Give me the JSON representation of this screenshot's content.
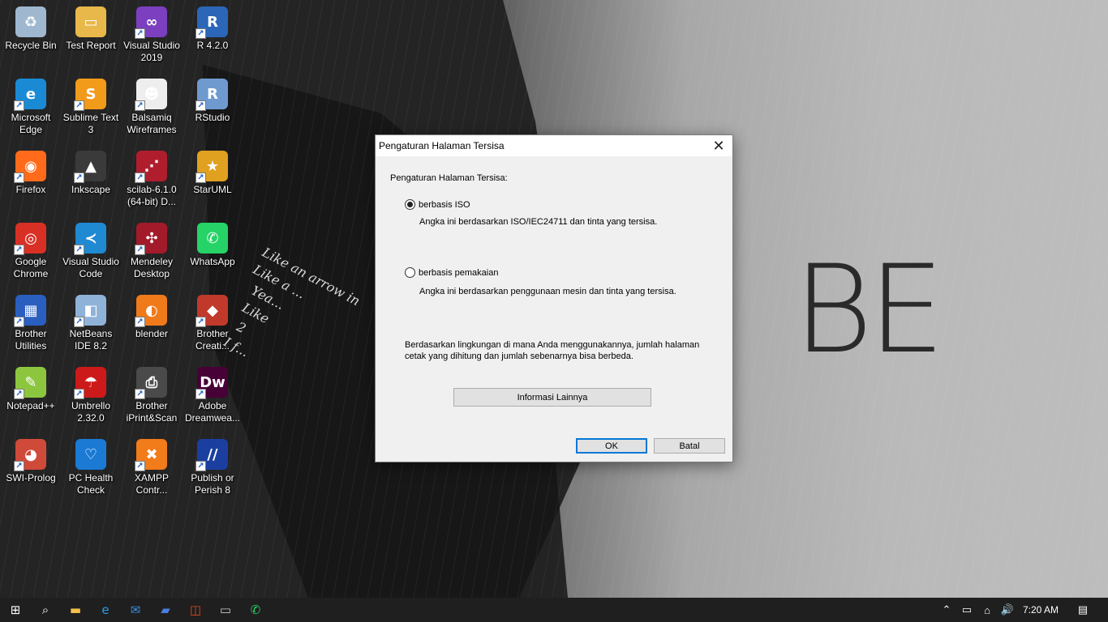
{
  "desktop": {
    "icons": [
      {
        "label": "Recycle Bin",
        "icon": "recycle-bin-icon",
        "color": "#9fb8d0",
        "glyph": "♻",
        "shortcut": false
      },
      {
        "label": "Test Report",
        "icon": "folder-icon",
        "color": "#e8b84a",
        "glyph": "▭",
        "shortcut": false
      },
      {
        "label": "Visual Studio 2019",
        "icon": "visual-studio-icon",
        "color": "#7b3fc0",
        "glyph": "∞",
        "shortcut": true
      },
      {
        "label": "R 4.2.0",
        "icon": "r-icon",
        "color": "#2b66b8",
        "glyph": "R",
        "shortcut": true
      },
      {
        "label": "Microsoft Edge",
        "icon": "edge-icon",
        "color": "#1a8ad4",
        "glyph": "e",
        "shortcut": true
      },
      {
        "label": "Sublime Text 3",
        "icon": "sublime-text-icon",
        "color": "#f29a1a",
        "glyph": "S",
        "shortcut": true
      },
      {
        "label": "Balsamiq Wireframes",
        "icon": "balsamiq-icon",
        "color": "#eeeeee",
        "glyph": "☻",
        "shortcut": true
      },
      {
        "label": "RStudio",
        "icon": "rstudio-icon",
        "color": "#6f9ad0",
        "glyph": "R",
        "shortcut": true
      },
      {
        "label": "Firefox",
        "icon": "firefox-icon",
        "color": "#ff6b1a",
        "glyph": "◉",
        "shortcut": true
      },
      {
        "label": "Inkscape",
        "icon": "inkscape-icon",
        "color": "#3a3a3a",
        "glyph": "▲",
        "shortcut": true
      },
      {
        "label": "scilab-6.1.0 (64-bit) D...",
        "icon": "scilab-icon",
        "color": "#b01e2e",
        "glyph": "⋰",
        "shortcut": true
      },
      {
        "label": "StarUML",
        "icon": "staruml-icon",
        "color": "#e0a020",
        "glyph": "★",
        "shortcut": true
      },
      {
        "label": "Google Chrome",
        "icon": "chrome-icon",
        "color": "#d93025",
        "glyph": "◎",
        "shortcut": true
      },
      {
        "label": "Visual Studio Code",
        "icon": "vscode-icon",
        "color": "#1f8ad2",
        "glyph": "≺",
        "shortcut": true
      },
      {
        "label": "Mendeley Desktop",
        "icon": "mendeley-icon",
        "color": "#a31a2a",
        "glyph": "✣",
        "shortcut": true
      },
      {
        "label": "WhatsApp",
        "icon": "whatsapp-icon",
        "color": "#25d366",
        "glyph": "✆",
        "shortcut": false
      },
      {
        "label": "Brother Utilities",
        "icon": "brother-utilities-icon",
        "color": "#2a5fc0",
        "glyph": "▦",
        "shortcut": true
      },
      {
        "label": "NetBeans IDE 8.2",
        "icon": "netbeans-icon",
        "color": "#8fb3d8",
        "glyph": "◧",
        "shortcut": true
      },
      {
        "label": "blender",
        "icon": "blender-icon",
        "color": "#f07a1a",
        "glyph": "◐",
        "shortcut": true
      },
      {
        "label": "Brother Creati...",
        "icon": "brother-creative-icon",
        "color": "#c0392b",
        "glyph": "◆",
        "shortcut": true
      },
      {
        "label": "Notepad++",
        "icon": "notepad-plus-plus-icon",
        "color": "#8cc63f",
        "glyph": "✎",
        "shortcut": true
      },
      {
        "label": "Umbrello 2.32.0",
        "icon": "umbrello-icon",
        "color": "#cc1a1a",
        "glyph": "☂",
        "shortcut": true
      },
      {
        "label": "Brother iPrint&Scan",
        "icon": "brother-iprint-icon",
        "color": "#4a4a4a",
        "glyph": "⎙",
        "shortcut": true
      },
      {
        "label": "Adobe Dreamwea...",
        "icon": "dreamweaver-icon",
        "color": "#470137",
        "glyph": "Dw",
        "shortcut": true
      },
      {
        "label": "SWI-Prolog",
        "icon": "swi-prolog-icon",
        "color": "#d04a3a",
        "glyph": "◕",
        "shortcut": true
      },
      {
        "label": "PC Health Check",
        "icon": "pc-health-check-icon",
        "color": "#1a7ad4",
        "glyph": "♡",
        "shortcut": false
      },
      {
        "label": "XAMPP Contr...",
        "icon": "xampp-icon",
        "color": "#f27b1a",
        "glyph": "✖",
        "shortcut": true
      },
      {
        "label": "Publish or Perish 8",
        "icon": "publish-or-perish-icon",
        "color": "#1a3fa0",
        "glyph": "//",
        "shortcut": true
      }
    ]
  },
  "wallpaper": {
    "logo_text": "BE",
    "lyrics": "Like an arrow in\nLike a ...\n  Yea...\n  Like\n   2\n  I f..."
  },
  "dialog": {
    "title": "Pengaturan Halaman Tersisa",
    "heading": "Pengaturan Halaman Tersisa:",
    "option_iso": {
      "label": "berbasis ISO",
      "description": "Angka ini berdasarkan ISO/IEC24711 dan tinta yang tersisa.",
      "selected": true
    },
    "option_usage": {
      "label": "berbasis pemakaian",
      "description": "Angka ini berdasarkan penggunaan mesin dan tinta yang tersisa.",
      "selected": false
    },
    "note": "Berdasarkan lingkungan di mana Anda menggunakannya, jumlah halaman cetak yang dihitung dan jumlah sebenarnya bisa berbeda.",
    "more_info_label": "Informasi Lainnya",
    "ok_label": "OK",
    "cancel_label": "Batal"
  },
  "taskbar": {
    "items": [
      {
        "name": "start-button",
        "icon": "windows-logo-icon",
        "glyph": "⊞",
        "color": "#ffffff"
      },
      {
        "name": "search-button",
        "icon": "search-icon",
        "glyph": "⌕",
        "color": "#ffffff"
      },
      {
        "name": "file-explorer-button",
        "icon": "folder-icon",
        "glyph": "▬",
        "color": "#f2c04a"
      },
      {
        "name": "edge-button",
        "icon": "edge-icon",
        "glyph": "e",
        "color": "#2a9ae4"
      },
      {
        "name": "mail-button",
        "icon": "mail-icon",
        "glyph": "✉",
        "color": "#3a8ee0"
      },
      {
        "name": "visual-studio-taskbar-button",
        "icon": "visual-studio-icon",
        "glyph": "▰",
        "color": "#4a7ee0"
      },
      {
        "name": "office-button",
        "icon": "office-icon",
        "glyph": "◫",
        "color": "#e04a1a"
      },
      {
        "name": "terminal-button",
        "icon": "terminal-icon",
        "glyph": "▭",
        "color": "#cccccc"
      },
      {
        "name": "whatsapp-taskbar-button",
        "icon": "whatsapp-icon",
        "glyph": "✆",
        "color": "#25d366"
      }
    ],
    "tray": [
      {
        "name": "show-hidden-icons-button",
        "icon": "chevron-up-icon",
        "glyph": "⌃"
      },
      {
        "name": "battery-indicator",
        "icon": "battery-icon",
        "glyph": "▭"
      },
      {
        "name": "meet-now-button",
        "icon": "camera-icon",
        "glyph": "⌂"
      },
      {
        "name": "volume-button",
        "icon": "speaker-icon",
        "glyph": "🔊"
      }
    ],
    "clock": "7:20 AM",
    "notification_icon": "notification-icon"
  }
}
